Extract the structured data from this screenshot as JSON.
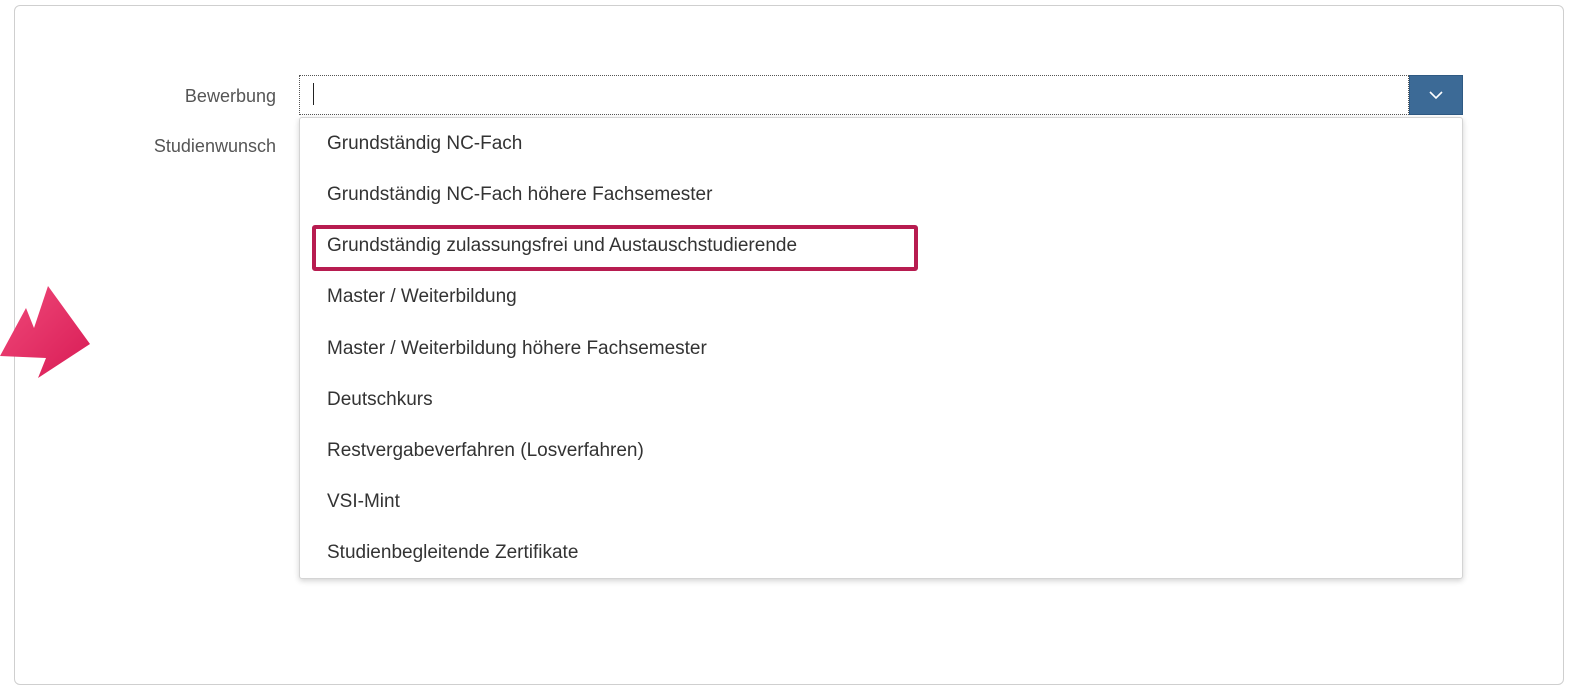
{
  "form": {
    "bewerbung_label": "Bewerbung",
    "studienwunsch_label": "Studienwunsch",
    "bewerbung_value": ""
  },
  "dropdown": {
    "toggle_icon": "chevron-down-icon",
    "options": [
      "Grundständig NC-Fach",
      "Grundständig NC-Fach höhere Fachsemester",
      "Grundständig zulassungsfrei und Austauschstudierende",
      "Master / Weiterbildung",
      "Master / Weiterbildung höhere Fachsemester",
      "Deutschkurs",
      "Restvergabeverfahren (Losverfahren)",
      "VSI-Mint",
      "Studienbegleitende Zertifikate"
    ],
    "highlighted_option": "Grundständig zulassungsfrei und Austauschstudierende"
  },
  "colors": {
    "accent": "#3c6a96",
    "highlight_border": "#b71c50",
    "arrow": "#e0245e"
  }
}
